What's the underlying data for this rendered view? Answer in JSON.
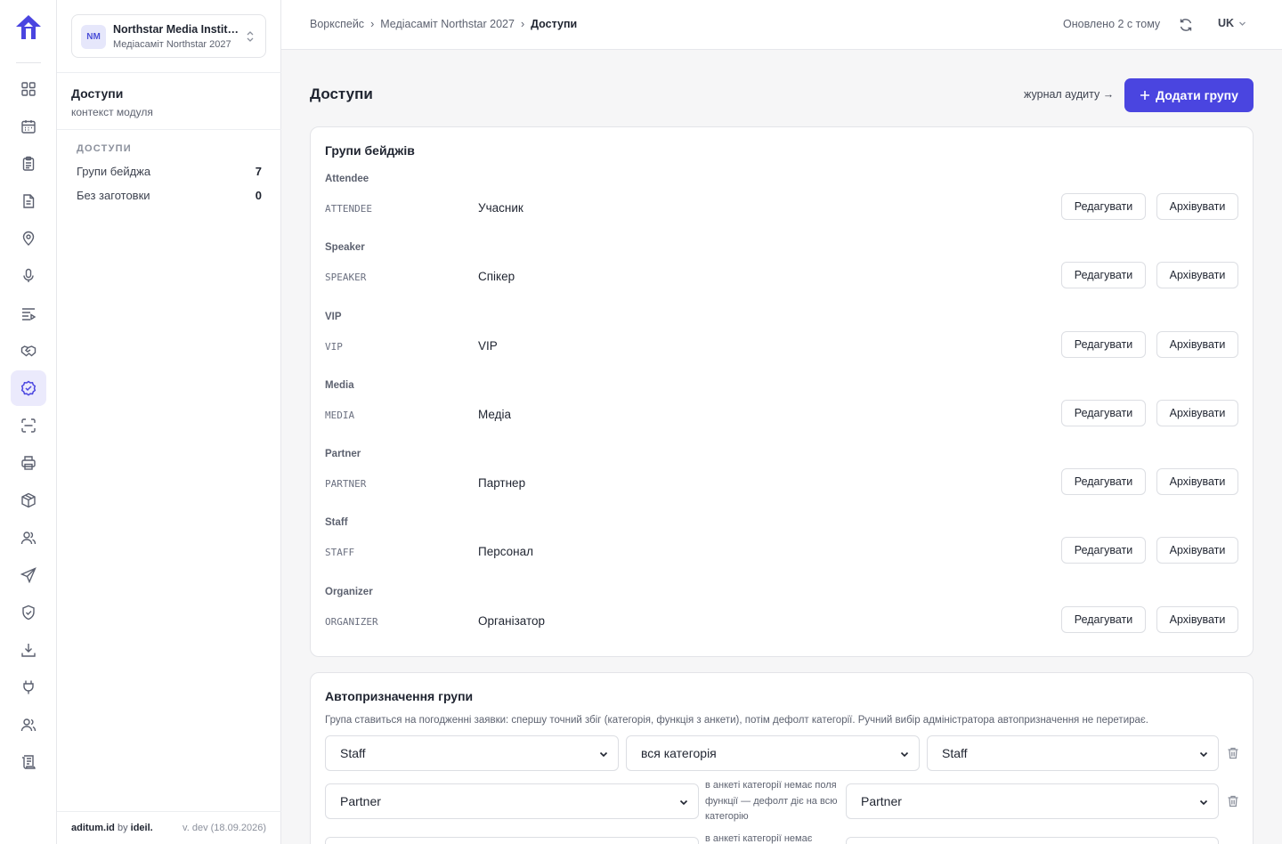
{
  "org": {
    "initials": "NM",
    "name": "Northstar Media Institute",
    "event": "Медіасаміт Northstar 2027"
  },
  "module": {
    "title": "Доступи",
    "subtitle": "контекст модуля",
    "section": "ДОСТУПИ",
    "items": [
      {
        "label": "Групи бейджа",
        "count": "7"
      },
      {
        "label": "Без заготовки",
        "count": "0"
      }
    ]
  },
  "footer": {
    "brand": "aditum.id",
    "by": "by",
    "maker": "ideil.",
    "version": "v. dev (18.09.2026)"
  },
  "breadcrumb": [
    "Воркспейс",
    "›",
    "Медіасаміт Northstar 2027",
    "›",
    "Доступи"
  ],
  "topbar": {
    "updated": "Оновлено 2 с тому",
    "lang": "UK"
  },
  "page": {
    "title": "Доступи",
    "audit_link": "журнал аудиту →",
    "add_button": "Додати групу"
  },
  "badge_groups": {
    "title": "Групи бейджів",
    "edit_label": "Редагувати",
    "archive_label": "Архівувати",
    "groups": [
      {
        "name": "Attendee",
        "code": "ATTENDEE",
        "label": "Учасник"
      },
      {
        "name": "Speaker",
        "code": "SPEAKER",
        "label": "Спікер"
      },
      {
        "name": "VIP",
        "code": "VIP",
        "label": "VIP"
      },
      {
        "name": "Media",
        "code": "MEDIA",
        "label": "Медіа"
      },
      {
        "name": "Partner",
        "code": "PARTNER",
        "label": "Партнер"
      },
      {
        "name": "Staff",
        "code": "STAFF",
        "label": "Персонал"
      },
      {
        "name": "Organizer",
        "code": "ORGANIZER",
        "label": "Організатор"
      }
    ]
  },
  "auto_assign": {
    "title": "Автопризначення групи",
    "description": "Група ставиться на погодженні заявки: спершу точний збіг (категорія, функція з анкети), потім дефолт категорії. Ручний вибір адміністратора автопризначення не перетирає.",
    "rules": [
      {
        "category": "Staff",
        "function": "вся категорія",
        "group": "Staff"
      },
      {
        "category": "Partner",
        "note": "в анкеті категорії немає поля функції — дефолт діє на всю категорію",
        "group": "Partner"
      },
      {
        "note": "в анкеті категорії немає"
      }
    ]
  },
  "colors": {
    "accent": "#4a45e0",
    "accent_soft": "#ebeafc",
    "icon": "#5a5f6e"
  },
  "rail_icons": [
    "dashboard-icon",
    "calendar-icon",
    "clipboard-icon",
    "document-icon",
    "location-icon",
    "microphone-icon",
    "agenda-icon",
    "handshake-icon",
    "access-check-icon",
    "scan-icon",
    "printer-icon",
    "box-icon",
    "users-icon",
    "send-icon",
    "shield-icon",
    "download-icon",
    "plug-icon",
    "team-icon",
    "scroll-icon"
  ]
}
